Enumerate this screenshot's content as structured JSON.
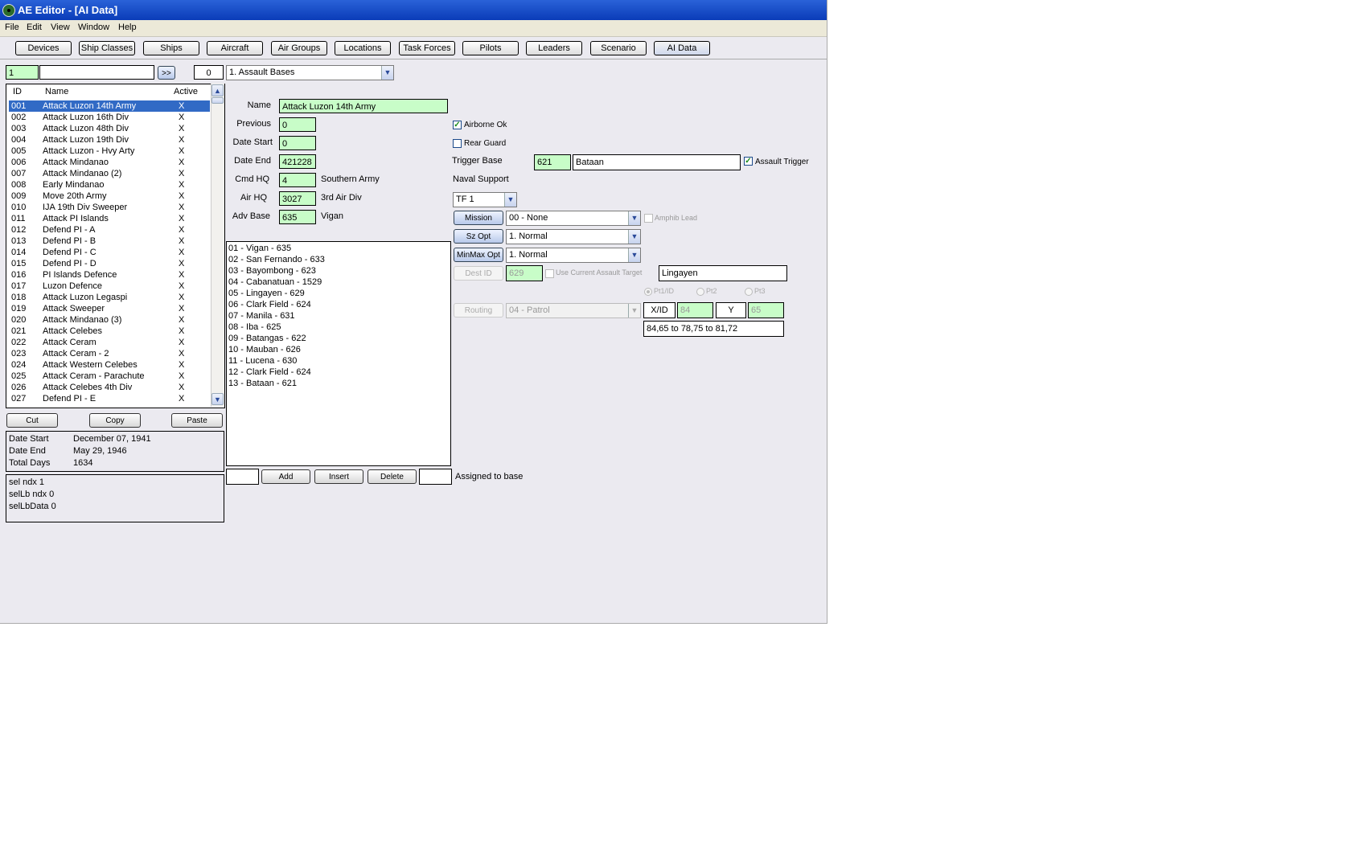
{
  "window": {
    "title": "AE Editor - [AI Data]"
  },
  "menu": [
    "File",
    "Edit",
    "View",
    "Window",
    "Help"
  ],
  "toolbar": [
    "Devices",
    "Ship Classes",
    "Ships",
    "Aircraft",
    "Air Groups",
    "Locations",
    "Task Forces",
    "Pilots",
    "Leaders",
    "Scenario",
    "AI Data"
  ],
  "search": {
    "id_value": "1",
    "text_value": "",
    "go_label": ">>",
    "count": "0"
  },
  "category_select": "1. Assault Bases",
  "list": {
    "headers": {
      "id": "ID",
      "name": "Name",
      "active": "Active"
    },
    "rows": [
      {
        "id": "001",
        "name": "Attack Luzon 14th Army",
        "active": "X"
      },
      {
        "id": "002",
        "name": "Attack Luzon 16th Div",
        "active": "X"
      },
      {
        "id": "003",
        "name": "Attack Luzon 48th Div",
        "active": "X"
      },
      {
        "id": "004",
        "name": "Attack Luzon 19th Div",
        "active": "X"
      },
      {
        "id": "005",
        "name": "Attack Luzon - Hvy Arty",
        "active": "X"
      },
      {
        "id": "006",
        "name": "Attack Mindanao",
        "active": "X"
      },
      {
        "id": "007",
        "name": "Attack Mindanao (2)",
        "active": "X"
      },
      {
        "id": "008",
        "name": "Early Mindanao",
        "active": "X"
      },
      {
        "id": "009",
        "name": "Move 20th Army",
        "active": "X"
      },
      {
        "id": "010",
        "name": "IJA 19th Div Sweeper",
        "active": "X"
      },
      {
        "id": "011",
        "name": "Attack PI Islands",
        "active": "X"
      },
      {
        "id": "012",
        "name": "Defend PI - A",
        "active": "X"
      },
      {
        "id": "013",
        "name": "Defend PI - B",
        "active": "X"
      },
      {
        "id": "014",
        "name": "Defend PI - C",
        "active": "X"
      },
      {
        "id": "015",
        "name": "Defend PI - D",
        "active": "X"
      },
      {
        "id": "016",
        "name": "PI Islands Defence",
        "active": "X"
      },
      {
        "id": "017",
        "name": "Luzon Defence",
        "active": "X"
      },
      {
        "id": "018",
        "name": "Attack Luzon Legaspi",
        "active": "X"
      },
      {
        "id": "019",
        "name": "Attack Sweeper",
        "active": "X"
      },
      {
        "id": "020",
        "name": "Attack Mindanao (3)",
        "active": "X"
      },
      {
        "id": "021",
        "name": "Attack Celebes",
        "active": "X"
      },
      {
        "id": "022",
        "name": "Attack Ceram",
        "active": "X"
      },
      {
        "id": "023",
        "name": "Attack Ceram - 2",
        "active": "X"
      },
      {
        "id": "024",
        "name": "Attack Western Celebes",
        "active": "X"
      },
      {
        "id": "025",
        "name": "Attack Ceram - Parachute",
        "active": "X"
      },
      {
        "id": "026",
        "name": "Attack Celebes 4th Div",
        "active": "X"
      },
      {
        "id": "027",
        "name": "Defend PI - E",
        "active": "X"
      }
    ]
  },
  "list_buttons": {
    "cut": "Cut",
    "copy": "Copy",
    "paste": "Paste"
  },
  "summary": {
    "date_start_label": "Date Start",
    "date_start": "December 07, 1941",
    "date_end_label": "Date End",
    "date_end": "May 29, 1946",
    "total_days_label": "Total Days",
    "total_days": "1634"
  },
  "debug": [
    "sel ndx 1",
    "selLb ndx 0",
    "selLbData 0"
  ],
  "form": {
    "name_label": "Name",
    "name": "Attack Luzon 14th Army",
    "previous_label": "Previous",
    "previous": "0",
    "date_start_label": "Date Start",
    "date_start": "0",
    "date_end_label": "Date End",
    "date_end": "421228",
    "cmd_hq_label": "Cmd HQ",
    "cmd_hq": "4",
    "cmd_hq_name": "Southern Army",
    "air_hq_label": "Air HQ",
    "air_hq": "3027",
    "air_hq_name": "3rd Air Div",
    "adv_base_label": "Adv Base",
    "adv_base": "635",
    "adv_base_name": "Vigan"
  },
  "bases": [
    "01 - Vigan - 635",
    "02 - San Fernando - 633",
    "03 - Bayombong - 623",
    "04 - Cabanatuan - 1529",
    "05 - Lingayen - 629",
    "06 - Clark Field - 624",
    "07 - Manila - 631",
    "08 - Iba - 625",
    "09 - Batangas - 622",
    "10 - Mauban - 626",
    "11 - Lucena - 630",
    "12 - Clark Field - 624",
    "13 - Bataan - 621"
  ],
  "base_buttons": {
    "add": "Add",
    "insert": "Insert",
    "delete": "Delete",
    "assigned_label": "Assigned to base"
  },
  "right": {
    "airborne_ok": "Airborne Ok",
    "rear_guard": "Rear Guard",
    "trigger_base_label": "Trigger Base",
    "trigger_base_id": "621",
    "trigger_base_name": "Bataan",
    "assault_trigger": "Assault Trigger",
    "naval_support_label": "Naval Support",
    "tf_select": "TF 1",
    "mission_btn": "Mission",
    "mission_value": "00 - None",
    "amphib_lead": "Amphib Lead",
    "sz_opt_btn": "Sz Opt",
    "sz_opt_value": "1. Normal",
    "minmax_btn": "MinMax Opt",
    "minmax_value": "1. Normal",
    "dest_id_btn": "Dest ID",
    "dest_id": "629",
    "use_current": "Use Current Assault Target",
    "dest_name": "Lingayen",
    "pt1": "Pt1/ID",
    "pt2": "Pt2",
    "pt3": "Pt3",
    "routing_btn": "Routing",
    "routing_value": "04 - Patrol",
    "xid_label": "X/ID",
    "x_value": "84",
    "y_label": "Y",
    "y_value": "65",
    "route_text": "84,65 to 78,75 to 81,72"
  }
}
